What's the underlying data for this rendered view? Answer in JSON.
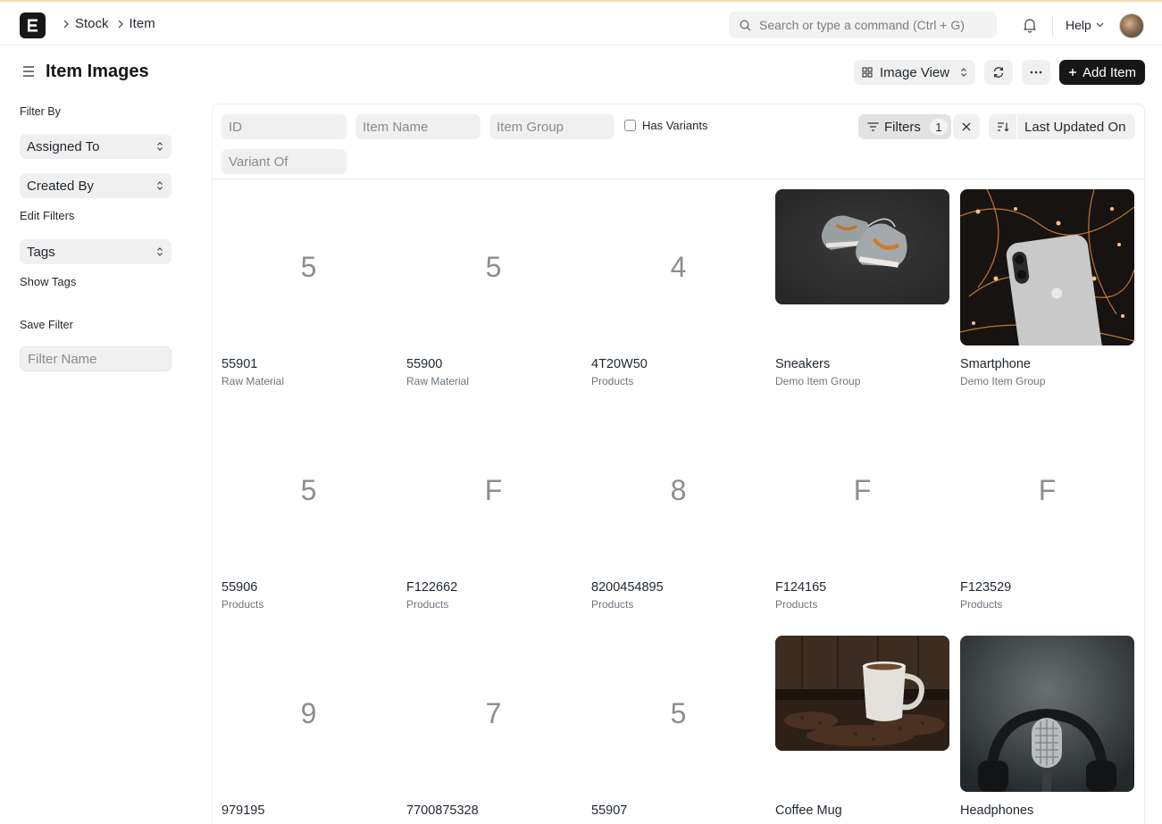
{
  "nav": {
    "breadcrumbs": [
      "Stock",
      "Item"
    ],
    "search_placeholder": "Search or type a command (Ctrl + G)",
    "help_label": "Help"
  },
  "page": {
    "title": "Item Images",
    "view_label": "Image View",
    "add_label": "Add Item"
  },
  "sidebar": {
    "filter_by": "Filter By",
    "assigned_to": "Assigned To",
    "created_by": "Created By",
    "edit_filters": "Edit Filters",
    "tags": "Tags",
    "show_tags": "Show Tags",
    "save_filter": "Save Filter",
    "filter_name_placeholder": "Filter Name"
  },
  "filters": {
    "id_placeholder": "ID",
    "item_name_placeholder": "Item Name",
    "item_group_placeholder": "Item Group",
    "variant_of_placeholder": "Variant Of",
    "has_variants_label": "Has Variants",
    "filters_label": "Filters",
    "filters_count": "1",
    "sort_label": "Last Updated On"
  },
  "items": [
    {
      "title": "55901",
      "group": "Raw Material",
      "initial": "5",
      "image": null
    },
    {
      "title": "55900",
      "group": "Raw Material",
      "initial": "5",
      "image": null
    },
    {
      "title": "4T20W50",
      "group": "Products",
      "initial": "4",
      "image": null
    },
    {
      "title": "Sneakers",
      "group": "Demo Item Group",
      "initial": "",
      "image": "sneakers-photo"
    },
    {
      "title": "Smartphone",
      "group": "Demo Item Group",
      "initial": "",
      "image": "smartphone-photo"
    },
    {
      "title": "55906",
      "group": "Products",
      "initial": "5",
      "image": null
    },
    {
      "title": "F122662",
      "group": "Products",
      "initial": "F",
      "image": null
    },
    {
      "title": "8200454895",
      "group": "Products",
      "initial": "8",
      "image": null
    },
    {
      "title": "F124165",
      "group": "Products",
      "initial": "F",
      "image": null
    },
    {
      "title": "F123529",
      "group": "Products",
      "initial": "F",
      "image": null
    },
    {
      "title": "979195",
      "group": "",
      "initial": "9",
      "image": null
    },
    {
      "title": "7700875328",
      "group": "",
      "initial": "7",
      "image": null
    },
    {
      "title": "55907",
      "group": "",
      "initial": "5",
      "image": null
    },
    {
      "title": "Coffee Mug",
      "group": "",
      "initial": "",
      "image": "coffee-mug-photo"
    },
    {
      "title": "Headphones",
      "group": "",
      "initial": "",
      "image": "headphones-photo"
    }
  ]
}
